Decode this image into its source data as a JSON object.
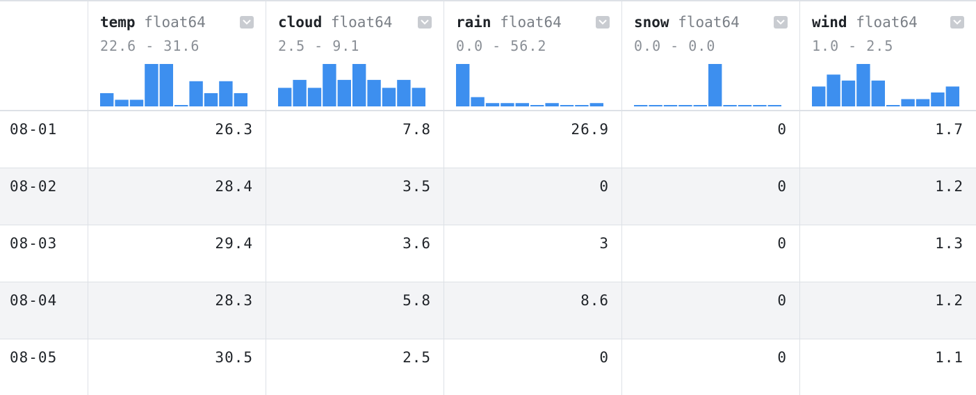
{
  "columns": [
    {
      "name": "temp",
      "dtype": "float64",
      "range": "22.6 - 31.6",
      "histogram": [
        10,
        5,
        5,
        32,
        32,
        1,
        19,
        10,
        19,
        10
      ]
    },
    {
      "name": "cloud",
      "dtype": "float64",
      "range": "2.5 - 9.1",
      "histogram": [
        14,
        20,
        14,
        32,
        20,
        32,
        20,
        14,
        20,
        14
      ]
    },
    {
      "name": "rain",
      "dtype": "float64",
      "range": "0.0 - 56.2",
      "histogram": [
        32,
        7,
        2.5,
        2.5,
        2.5,
        1,
        2.5,
        1,
        1,
        2.5
      ]
    },
    {
      "name": "snow",
      "dtype": "float64",
      "range": "0.0 - 0.0",
      "histogram": [
        1,
        1,
        1,
        1,
        1,
        32,
        1,
        1,
        1,
        1
      ]
    },
    {
      "name": "wind",
      "dtype": "float64",
      "range": "1.0 - 2.5",
      "histogram": [
        15,
        24,
        19.5,
        32,
        19.5,
        1,
        5.5,
        5.5,
        10.5,
        15
      ]
    }
  ],
  "rows": [
    {
      "index": "08-01",
      "values": [
        "26.3",
        "7.8",
        "26.9",
        "0",
        "1.7"
      ]
    },
    {
      "index": "08-02",
      "values": [
        "28.4",
        "3.5",
        "0",
        "0",
        "1.2"
      ]
    },
    {
      "index": "08-03",
      "values": [
        "29.4",
        "3.6",
        "3",
        "0",
        "1.3"
      ]
    },
    {
      "index": "08-04",
      "values": [
        "28.3",
        "5.8",
        "8.6",
        "0",
        "1.2"
      ]
    },
    {
      "index": "08-05",
      "values": [
        "30.5",
        "2.5",
        "0",
        "0",
        "1.1"
      ]
    }
  ],
  "colors": {
    "bar": "#3d8fef",
    "alt_row": "#f3f4f6",
    "border": "#dde1e6"
  }
}
